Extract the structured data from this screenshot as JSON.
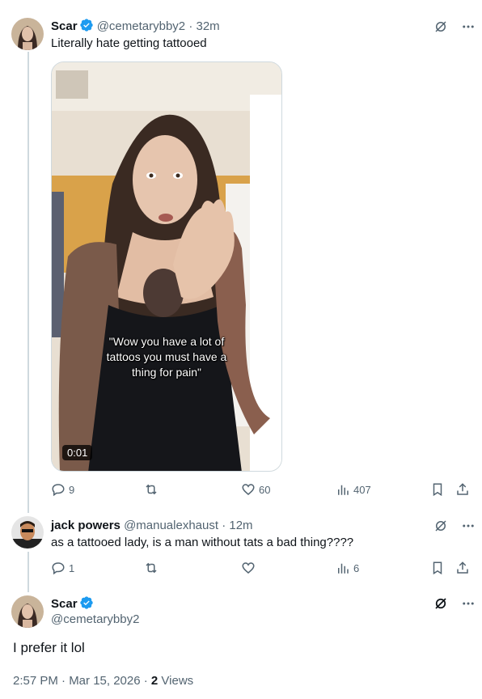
{
  "tweet1": {
    "name": "Scar",
    "handle": "@cemetarybby2",
    "time": "· 32m",
    "text": "Literally hate getting tattooed",
    "video": {
      "caption_line1": "\"Wow you have a lot of",
      "caption_line2": "tattoos you must have a",
      "caption_line3": "thing for pain\"",
      "timer": "0:01"
    },
    "actions": {
      "replies": "9",
      "likes": "60",
      "views": "407"
    }
  },
  "tweet2": {
    "name": "jack powers",
    "handle": "@manualexhaust",
    "time": "· 12m",
    "text": "as a tattooed lady, is a man without tats a bad thing????",
    "actions": {
      "replies": "1",
      "views": "6"
    }
  },
  "tweet3": {
    "name": "Scar",
    "handle": "@cemetarybby2",
    "text": "I prefer it lol",
    "date": "2:57 PM · Mar 15, 2026 · ",
    "views_count": "2",
    "views_label": " Views"
  },
  "colors": {
    "verified": "#1d9bf0",
    "secondary_text": "#536471",
    "divider": "#cfd9de"
  }
}
